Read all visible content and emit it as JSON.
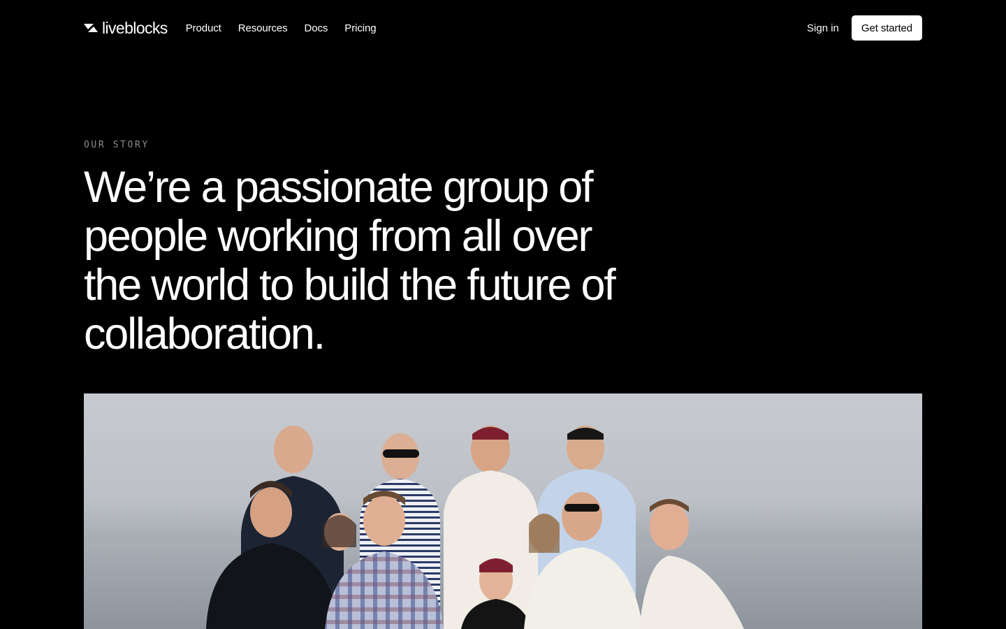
{
  "brand": {
    "name": "liveblocks",
    "logo_icon": "liveblocks-logo-icon"
  },
  "nav": {
    "links": [
      {
        "label": "Product"
      },
      {
        "label": "Resources"
      },
      {
        "label": "Docs"
      },
      {
        "label": "Pricing"
      }
    ],
    "signin_label": "Sign in",
    "cta_label": "Get started"
  },
  "hero": {
    "eyebrow": "OUR STORY",
    "headline": "We’re a passionate group of people working from all over the world to build the future of collaboration."
  },
  "team_photo": {
    "alt": "team-photo"
  },
  "colors": {
    "background": "#000000",
    "text": "#ffffff",
    "cta_bg": "#ffffff",
    "eyebrow": "#8a8a8a"
  }
}
